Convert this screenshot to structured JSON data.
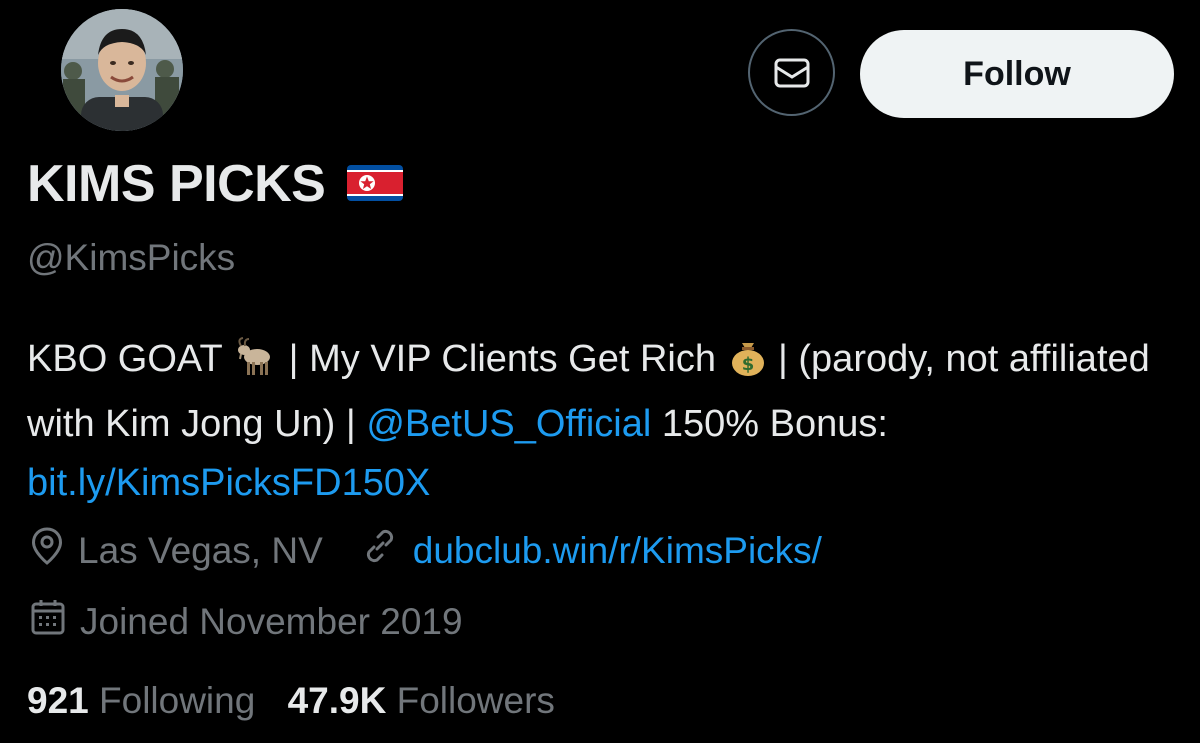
{
  "profile": {
    "display_name": "KIMS PICKS",
    "name_flag_icon": "north-korea-flag-icon",
    "handle": "@KimsPicks",
    "avatar_icon": "profile-photo"
  },
  "actions": {
    "message_icon": "envelope-icon",
    "follow_label": "Follow"
  },
  "bio": {
    "part1": "KBO GOAT",
    "emoji1": "goat-icon",
    "part2": "| My VIP Clients Get Rich",
    "emoji2": "money-bag-icon",
    "part3": "| (parody, not affiliated with Kim Jong Un) |",
    "mention": "@BetUS_Official",
    "part4": "150% Bonus:",
    "url": "bit.ly/KimsPicksFD150X"
  },
  "meta": {
    "location": "Las Vegas, NV",
    "website": "dubclub.win/r/KimsPicks/",
    "joined": "Joined November 2019"
  },
  "stats": {
    "following_count": "921",
    "following_label": "Following",
    "followers_count": "47.9K",
    "followers_label": "Followers"
  },
  "colors": {
    "background": "#000000",
    "text_primary": "#e7e9ea",
    "text_secondary": "#71767b",
    "link": "#1d9bf0",
    "follow_button_bg": "#eff3f4"
  }
}
